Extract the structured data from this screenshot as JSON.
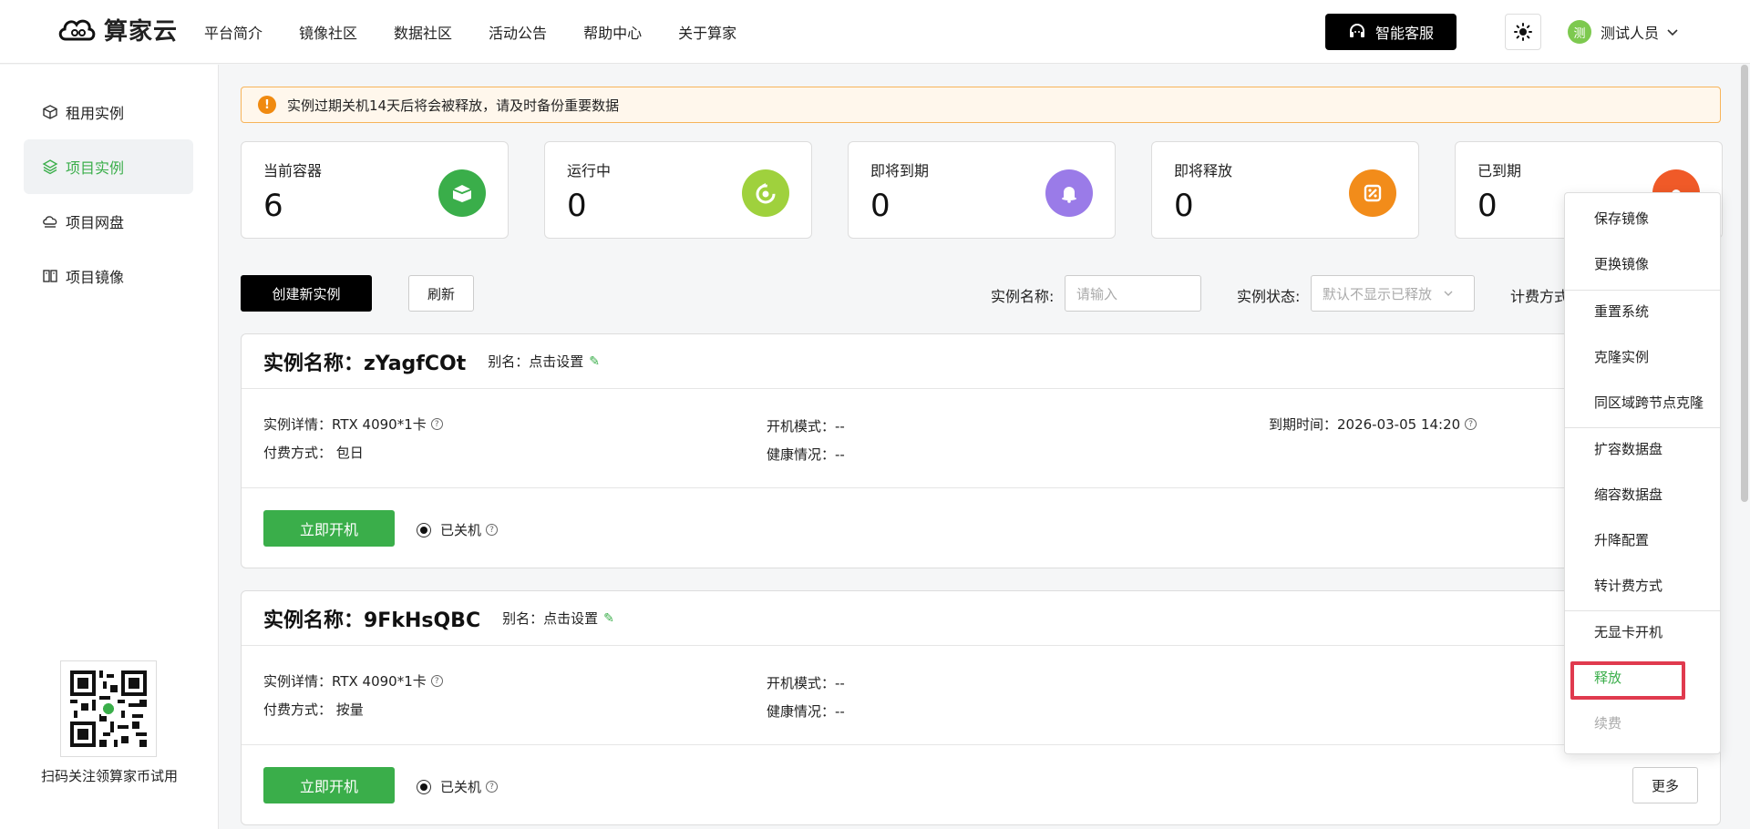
{
  "header": {
    "logo_text": "算家云",
    "nav": [
      "平台简介",
      "镜像社区",
      "数据社区",
      "活动公告",
      "帮助中心",
      "关于算家"
    ],
    "support_label": "智能客服",
    "user_avatar": "测",
    "user_name": "测试人员"
  },
  "sidebar": {
    "items": [
      "租用实例",
      "项目实例",
      "项目网盘",
      "项目镜像"
    ],
    "qr_caption": "扫码关注领算家币试用"
  },
  "alert": {
    "text": "实例过期关机14天后将会被释放，请及时备份重要数据"
  },
  "stats": [
    {
      "label": "当前容器",
      "value": "6"
    },
    {
      "label": "运行中",
      "value": "0"
    },
    {
      "label": "即将到期",
      "value": "0"
    },
    {
      "label": "即将释放",
      "value": "0"
    },
    {
      "label": "已到期",
      "value": "0"
    }
  ],
  "toolbar": {
    "create_label": "创建新实例",
    "refresh_label": "刷新",
    "name_label": "实例名称:",
    "name_placeholder": "请输入",
    "status_label": "实例状态:",
    "status_value": "默认不显示已释放",
    "billing_label": "计费方式"
  },
  "instances": [
    {
      "title": "实例名称：zYagfCOt",
      "alias": "别名：点击设置",
      "detail": "实例详情：RTX 4090*1卡",
      "billing": "付费方式：  包日",
      "boot_mode": "开机模式：--",
      "health": "健康情况：--",
      "expire": "到期时间：2026-03-05 14:20",
      "start_label": "立即开机",
      "status": "已关机"
    },
    {
      "title": "实例名称：9FkHsQBC",
      "alias": "别名：点击设置",
      "detail": "实例详情：RTX 4090*1卡",
      "billing": "付费方式：  按量",
      "boot_mode": "开机模式：--",
      "health": "健康情况：--",
      "start_label": "立即开机",
      "status": "已关机",
      "more_label": "更多"
    }
  ],
  "menu": {
    "items": [
      "保存镜像",
      "更换镜像",
      "重置系统",
      "克隆实例",
      "同区域跨节点克隆",
      "扩容数据盘",
      "缩容数据盘",
      "升降配置",
      "转计费方式",
      "无显卡开机",
      "释放",
      "续费"
    ]
  },
  "colors": {
    "accent": "#3aae4a",
    "stat_icons": [
      "#3aae4a",
      "#9fd13d",
      "#9a7be8",
      "#f28c1a",
      "#f05a28"
    ],
    "alert_border": "#f7b45a",
    "highlight_box": "#e03a4e"
  }
}
